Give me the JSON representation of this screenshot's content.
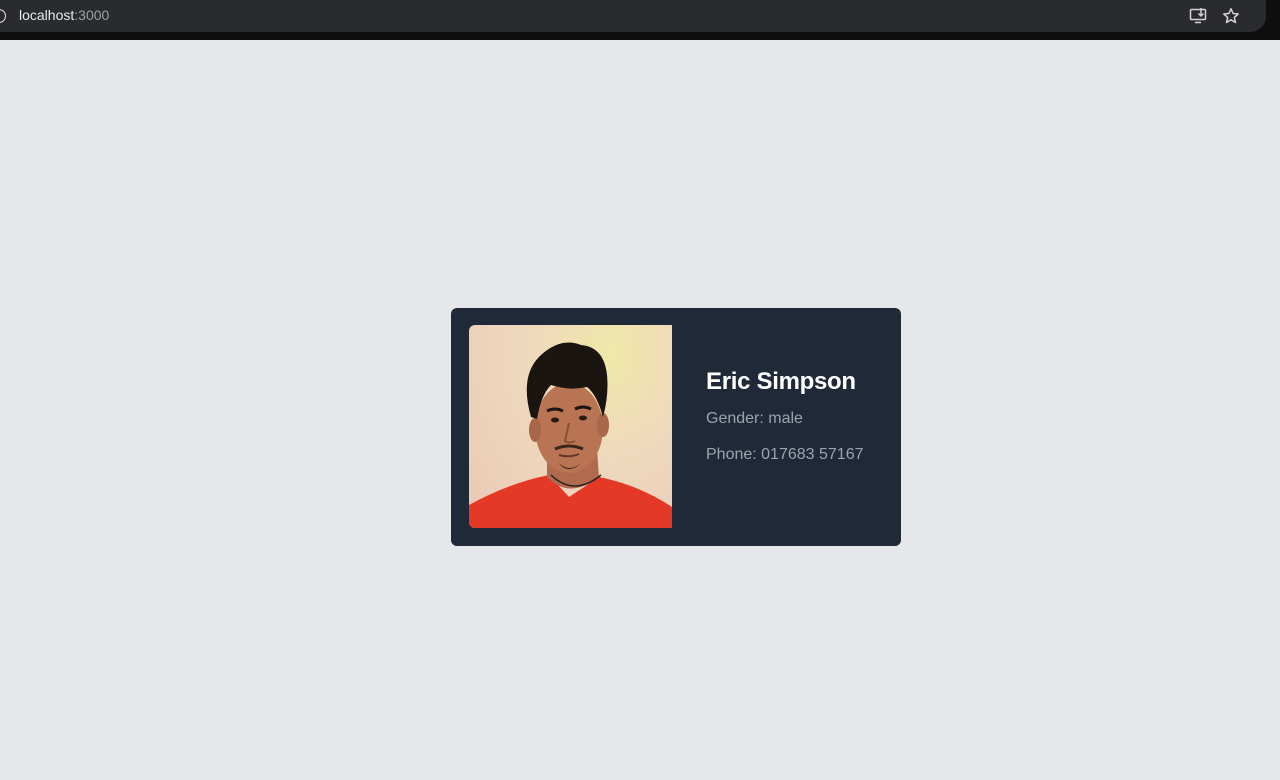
{
  "browser": {
    "url_host": "localhost",
    "url_port": ":3000",
    "info_icon": "info-icon",
    "install_icon": "install-app-icon",
    "bookmark_icon": "star-icon"
  },
  "card": {
    "name": "Eric Simpson",
    "gender": "Gender: male",
    "phone": "Phone: 017683 57167",
    "background_color": "#1f2937"
  },
  "page": {
    "background_color": "#e5e7eb"
  }
}
